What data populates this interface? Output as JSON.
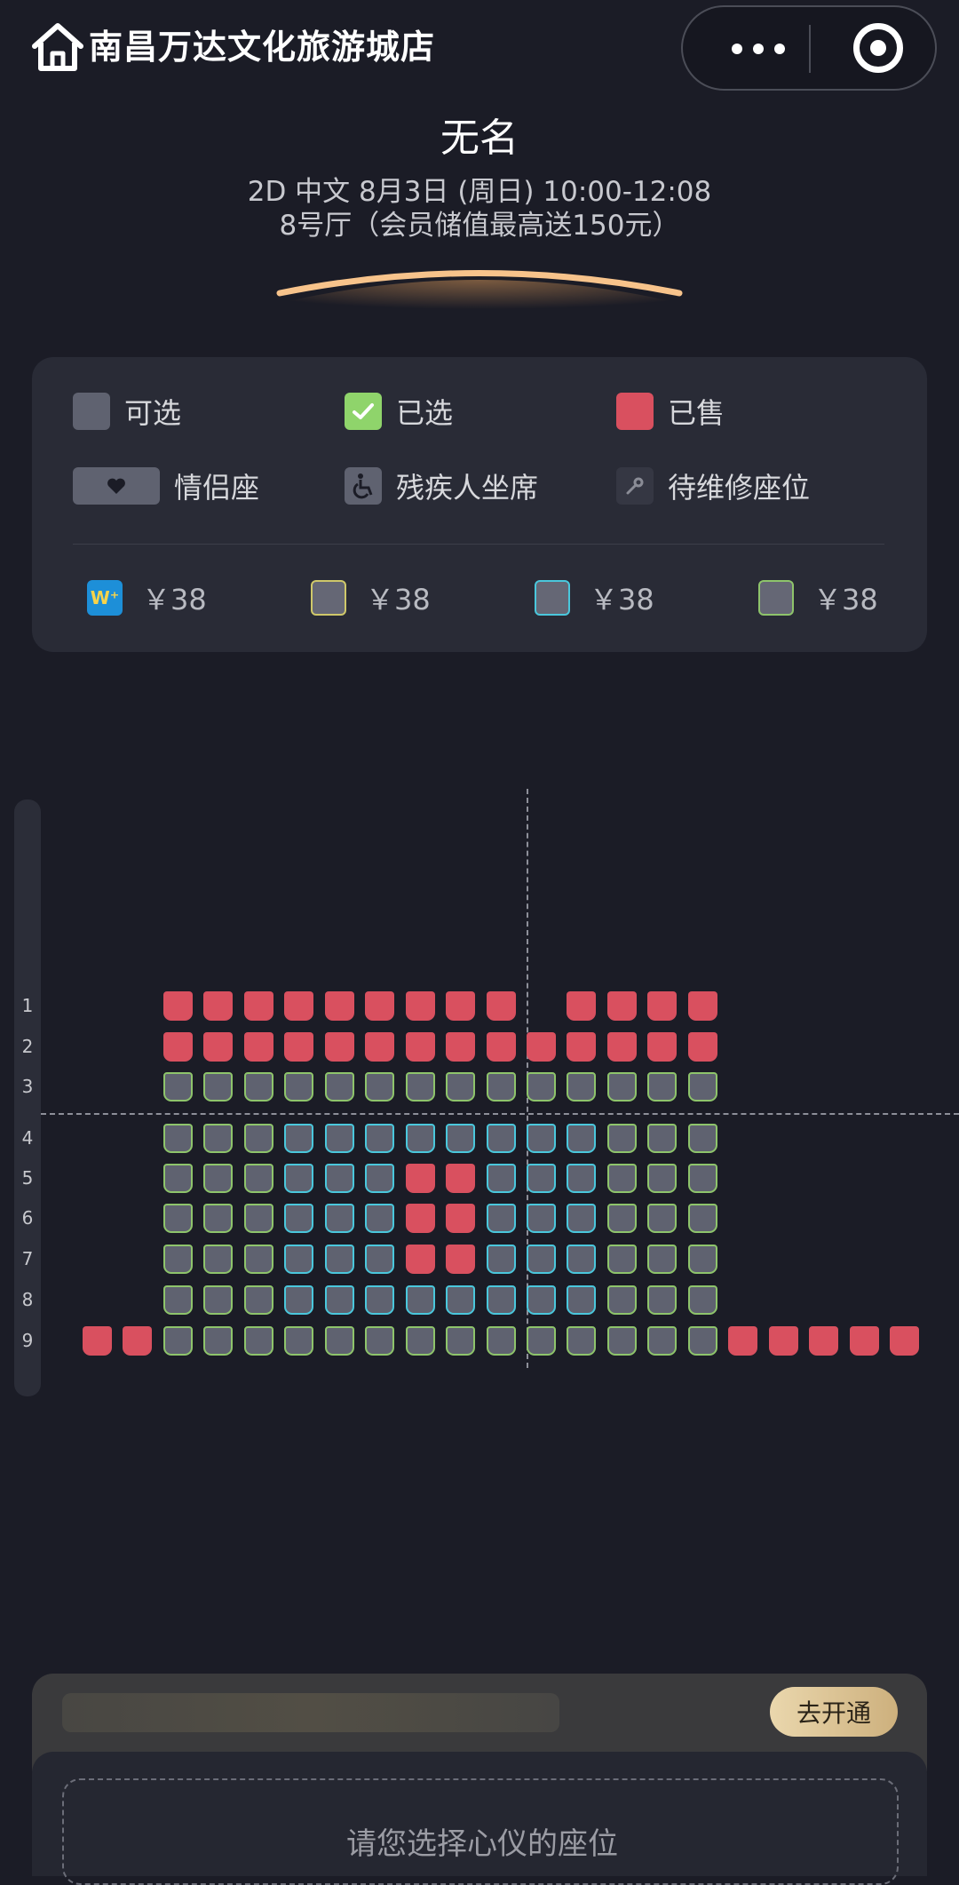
{
  "header": {
    "cinema_name": "南昌万达文化旅游城店",
    "icons": [
      "home-icon",
      "more-icon",
      "target-icon"
    ]
  },
  "movie": {
    "title": "无名",
    "show_info": "2D 中文 8月3日 (周日) 10:00-12:08",
    "hall_info": "8号厅（会员储值最高送150元）"
  },
  "legend": {
    "available": "可选",
    "selected": "已选",
    "sold": "已售",
    "couple": "情侣座",
    "accessible": "残疾人坐席",
    "maintenance": "待维修座位",
    "prices": [
      "￥38",
      "￥38",
      "￥38",
      "￥38"
    ],
    "price_tiers": [
      "wplus",
      "yellow",
      "cyan",
      "green"
    ]
  },
  "colors": {
    "background": "#1b1c26",
    "available": "#5f6270",
    "selected": "#8fd46b",
    "sold": "#d9505f",
    "tier_green": "#8ec46b",
    "tier_cyan": "#4ac7dc",
    "tier_yellow": "#cfc86a"
  },
  "seat_map": {
    "rows": [
      "1",
      "2",
      "3",
      "4",
      "5",
      "6",
      "7",
      "8",
      "9"
    ],
    "legend_codes": {
      "R": "sold",
      "G": "available (green tier)",
      "B": "available (cyan tier)",
      "_": "no seat"
    },
    "layout": [
      "__RRRRRRRRR_RRRR_____",
      "__RRRRRRRRRRRRRR_____",
      "__GGGGGGGGGGGGGG_____",
      "__GGGBBBBBBBBGGG_____",
      "__GGGBBBRRBBBGGG_____",
      "__GGGBBBRRBBBGGG_____",
      "__GGGBBBRRBBBGGG_____",
      "__GGGBBBBBBBBGGG_____",
      "RRGGGGGGGGGGGGGGRRRRR"
    ]
  },
  "bottom": {
    "vip_button": "去开通",
    "select_hint": "请您选择心仪的座位"
  }
}
